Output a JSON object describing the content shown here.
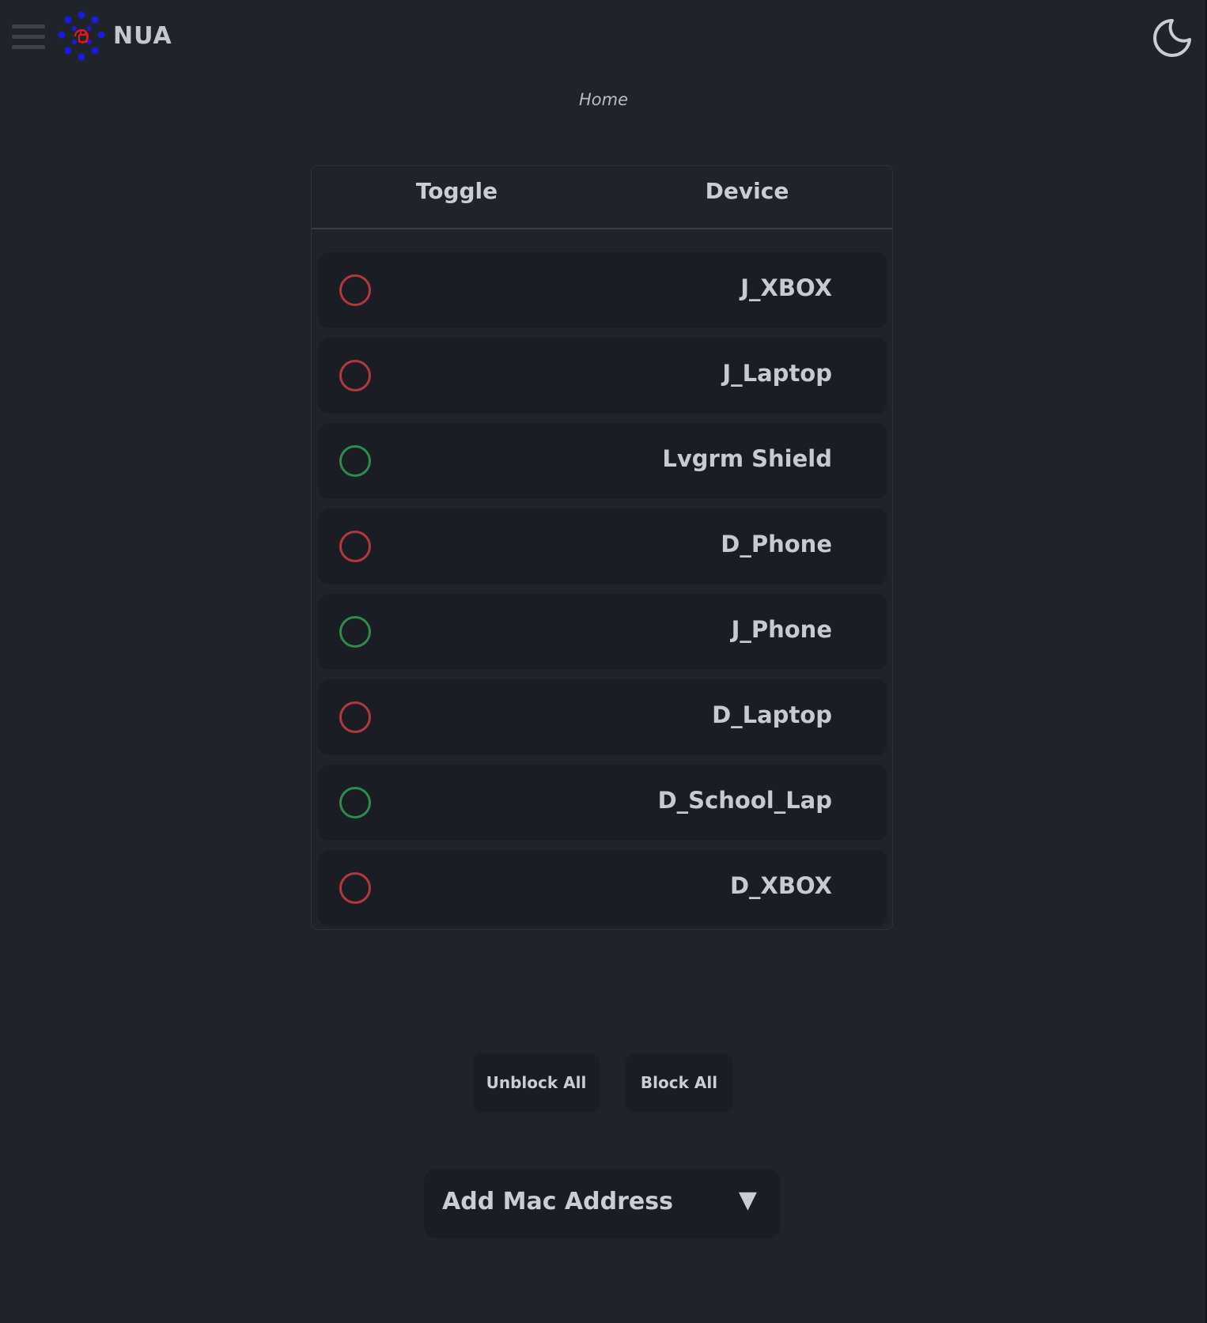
{
  "header": {
    "brand": "NUA",
    "menu_icon": "hamburger-menu-icon",
    "logo_icon": "nua-logo",
    "theme_icon": "crescent-moon-icon"
  },
  "breadcrumb": "Home",
  "table": {
    "headers": [
      "Toggle",
      "Device"
    ],
    "rows": [
      {
        "device": "J_XBOX",
        "status": "blocked"
      },
      {
        "device": "J_Laptop",
        "status": "blocked"
      },
      {
        "device": "Lvgrm Shield",
        "status": "unblocked"
      },
      {
        "device": "D_Phone",
        "status": "blocked"
      },
      {
        "device": "J_Phone",
        "status": "unblocked"
      },
      {
        "device": "D_Laptop",
        "status": "blocked"
      },
      {
        "device": "D_School_Lap",
        "status": "unblocked"
      },
      {
        "device": "D_XBOX",
        "status": "blocked"
      }
    ]
  },
  "actions": {
    "unblock_all": "Unblock All",
    "block_all": "Block All"
  },
  "add_mac": {
    "label": "Add Mac Address",
    "caret": "▼"
  },
  "colors": {
    "background": "#1f232a",
    "blocked": "#b3373e",
    "unblocked": "#2f8a4c",
    "logo_blue": "#1a1adf",
    "logo_red": "#e01818"
  }
}
